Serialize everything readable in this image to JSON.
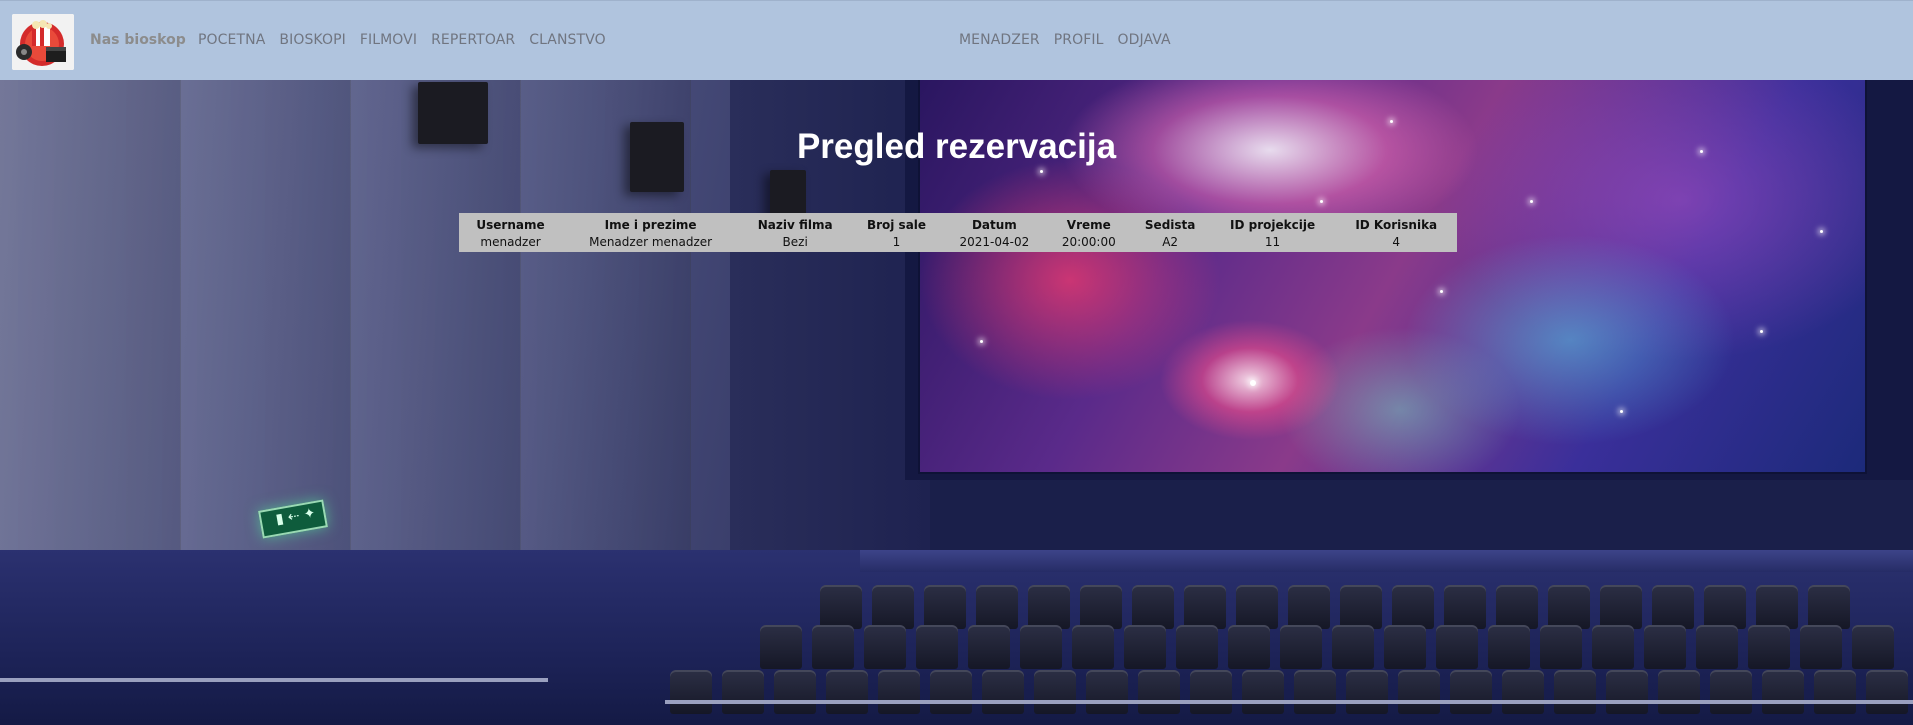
{
  "brand": {
    "name": "Nas bioskop"
  },
  "nav": {
    "left": [
      "POCETNA",
      "BIOSKOPI",
      "FILMOVI",
      "REPERTOAR",
      "CLANSTVO"
    ],
    "right": [
      "MENADZER",
      "PROFIL",
      "ODJAVA"
    ]
  },
  "page": {
    "title": "Pregled rezervacija"
  },
  "table": {
    "headers": [
      "Username",
      "Ime i prezime",
      "Naziv filma",
      "Broj sale",
      "Datum",
      "Vreme",
      "Sedista",
      "ID projekcije",
      "ID Korisnika"
    ],
    "rows": [
      [
        "menadzer",
        "Menadzer menadzer",
        "Bezi",
        "1",
        "2021-04-02",
        "20:00:00",
        "A2",
        "11",
        "4"
      ]
    ]
  },
  "icons": {
    "logo": "cinema-logo-icon",
    "exit": "exit-sign-icon"
  },
  "colors": {
    "navbar": "#b0c4de",
    "table_bg": "#c0c0c0",
    "title": "#ffffff"
  }
}
